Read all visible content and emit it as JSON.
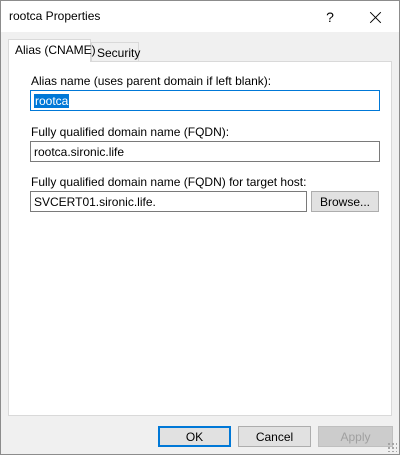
{
  "window": {
    "title": "rootca Properties"
  },
  "titlebar": {
    "help_label": "?"
  },
  "tabs": [
    {
      "label": "Alias (CNAME)",
      "active": true
    },
    {
      "label": "Security",
      "active": false
    }
  ],
  "form": {
    "alias": {
      "label": "Alias name (uses parent domain if left blank):",
      "value": "rootca"
    },
    "fqdn": {
      "label": "Fully qualified domain name (FQDN):",
      "value": "rootca.sironic.life"
    },
    "target": {
      "label": "Fully qualified domain name (FQDN) for target host:",
      "value": "SVCERT01.sironic.life."
    },
    "browse_label": "Browse..."
  },
  "footer": {
    "ok_label": "OK",
    "cancel_label": "Cancel",
    "apply_label": "Apply"
  },
  "colors": {
    "accent": "#0078d7",
    "selection": "#0078d7"
  }
}
